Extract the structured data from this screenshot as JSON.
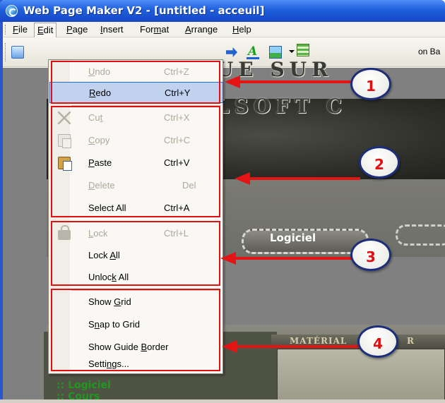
{
  "window": {
    "title": "Web Page Maker V2 - [untitled - acceuil]"
  },
  "menubar": {
    "items": [
      {
        "pre": "",
        "key": "F",
        "post": "ile"
      },
      {
        "pre": "",
        "key": "E",
        "post": "dit"
      },
      {
        "pre": "",
        "key": "P",
        "post": "age"
      },
      {
        "pre": "",
        "key": "I",
        "post": "nsert"
      },
      {
        "pre": "For",
        "key": "m",
        "post": "at"
      },
      {
        "pre": "",
        "key": "A",
        "post": "rrange"
      },
      {
        "pre": "",
        "key": "H",
        "post": "elp"
      }
    ]
  },
  "toolbar": {
    "label_fragment": "on Ba"
  },
  "page": {
    "nav_tab": "Logiciel",
    "column_header": "MATÉRIAL",
    "column_header_fragment": "R",
    "side_links": [
      ":: Logiciel",
      ":: Cours"
    ]
  },
  "edit_menu": {
    "items": [
      {
        "pre": "",
        "key": "U",
        "post": "ndo",
        "shortcut": "Ctrl+Z",
        "enabled": false
      },
      {
        "pre": "",
        "key": "R",
        "post": "edo",
        "shortcut": "Ctrl+Y",
        "enabled": true,
        "highlighted": true
      },
      {
        "pre": "Cu",
        "key": "t",
        "post": "",
        "shortcut": "Ctrl+X",
        "enabled": false,
        "icon": "scissors-icon"
      },
      {
        "pre": "",
        "key": "C",
        "post": "opy",
        "shortcut": "Ctrl+C",
        "enabled": false,
        "icon": "copy-icon"
      },
      {
        "pre": "",
        "key": "P",
        "post": "aste",
        "shortcut": "Ctrl+V",
        "enabled": true,
        "icon": "clipboard-icon"
      },
      {
        "pre": "",
        "key": "D",
        "post": "elete",
        "shortcut": "Del",
        "enabled": false
      },
      {
        "pre": "Select All",
        "key": "",
        "post": "",
        "shortcut": "Ctrl+A",
        "enabled": true
      },
      {
        "pre": "",
        "key": "L",
        "post": "ock",
        "shortcut": "Ctrl+L",
        "enabled": false,
        "icon": "lock-icon"
      },
      {
        "pre": "Lock ",
        "key": "A",
        "post": "ll",
        "shortcut": "",
        "enabled": true
      },
      {
        "pre": "Unloc",
        "key": "k",
        "post": " All",
        "shortcut": "",
        "enabled": true
      },
      {
        "pre": "Show ",
        "key": "G",
        "post": "rid",
        "shortcut": "",
        "enabled": true
      },
      {
        "pre": "S",
        "key": "n",
        "post": "ap to Grid",
        "shortcut": "",
        "enabled": true
      },
      {
        "pre": "Show Guide ",
        "key": "B",
        "post": "order",
        "shortcut": "",
        "enabled": true
      },
      {
        "pre": "Setti",
        "key": "n",
        "post": "gs...",
        "shortcut": "",
        "enabled": true
      }
    ]
  },
  "annotations": {
    "callouts": [
      "1",
      "2",
      "3",
      "4"
    ],
    "color": "#e01010"
  }
}
